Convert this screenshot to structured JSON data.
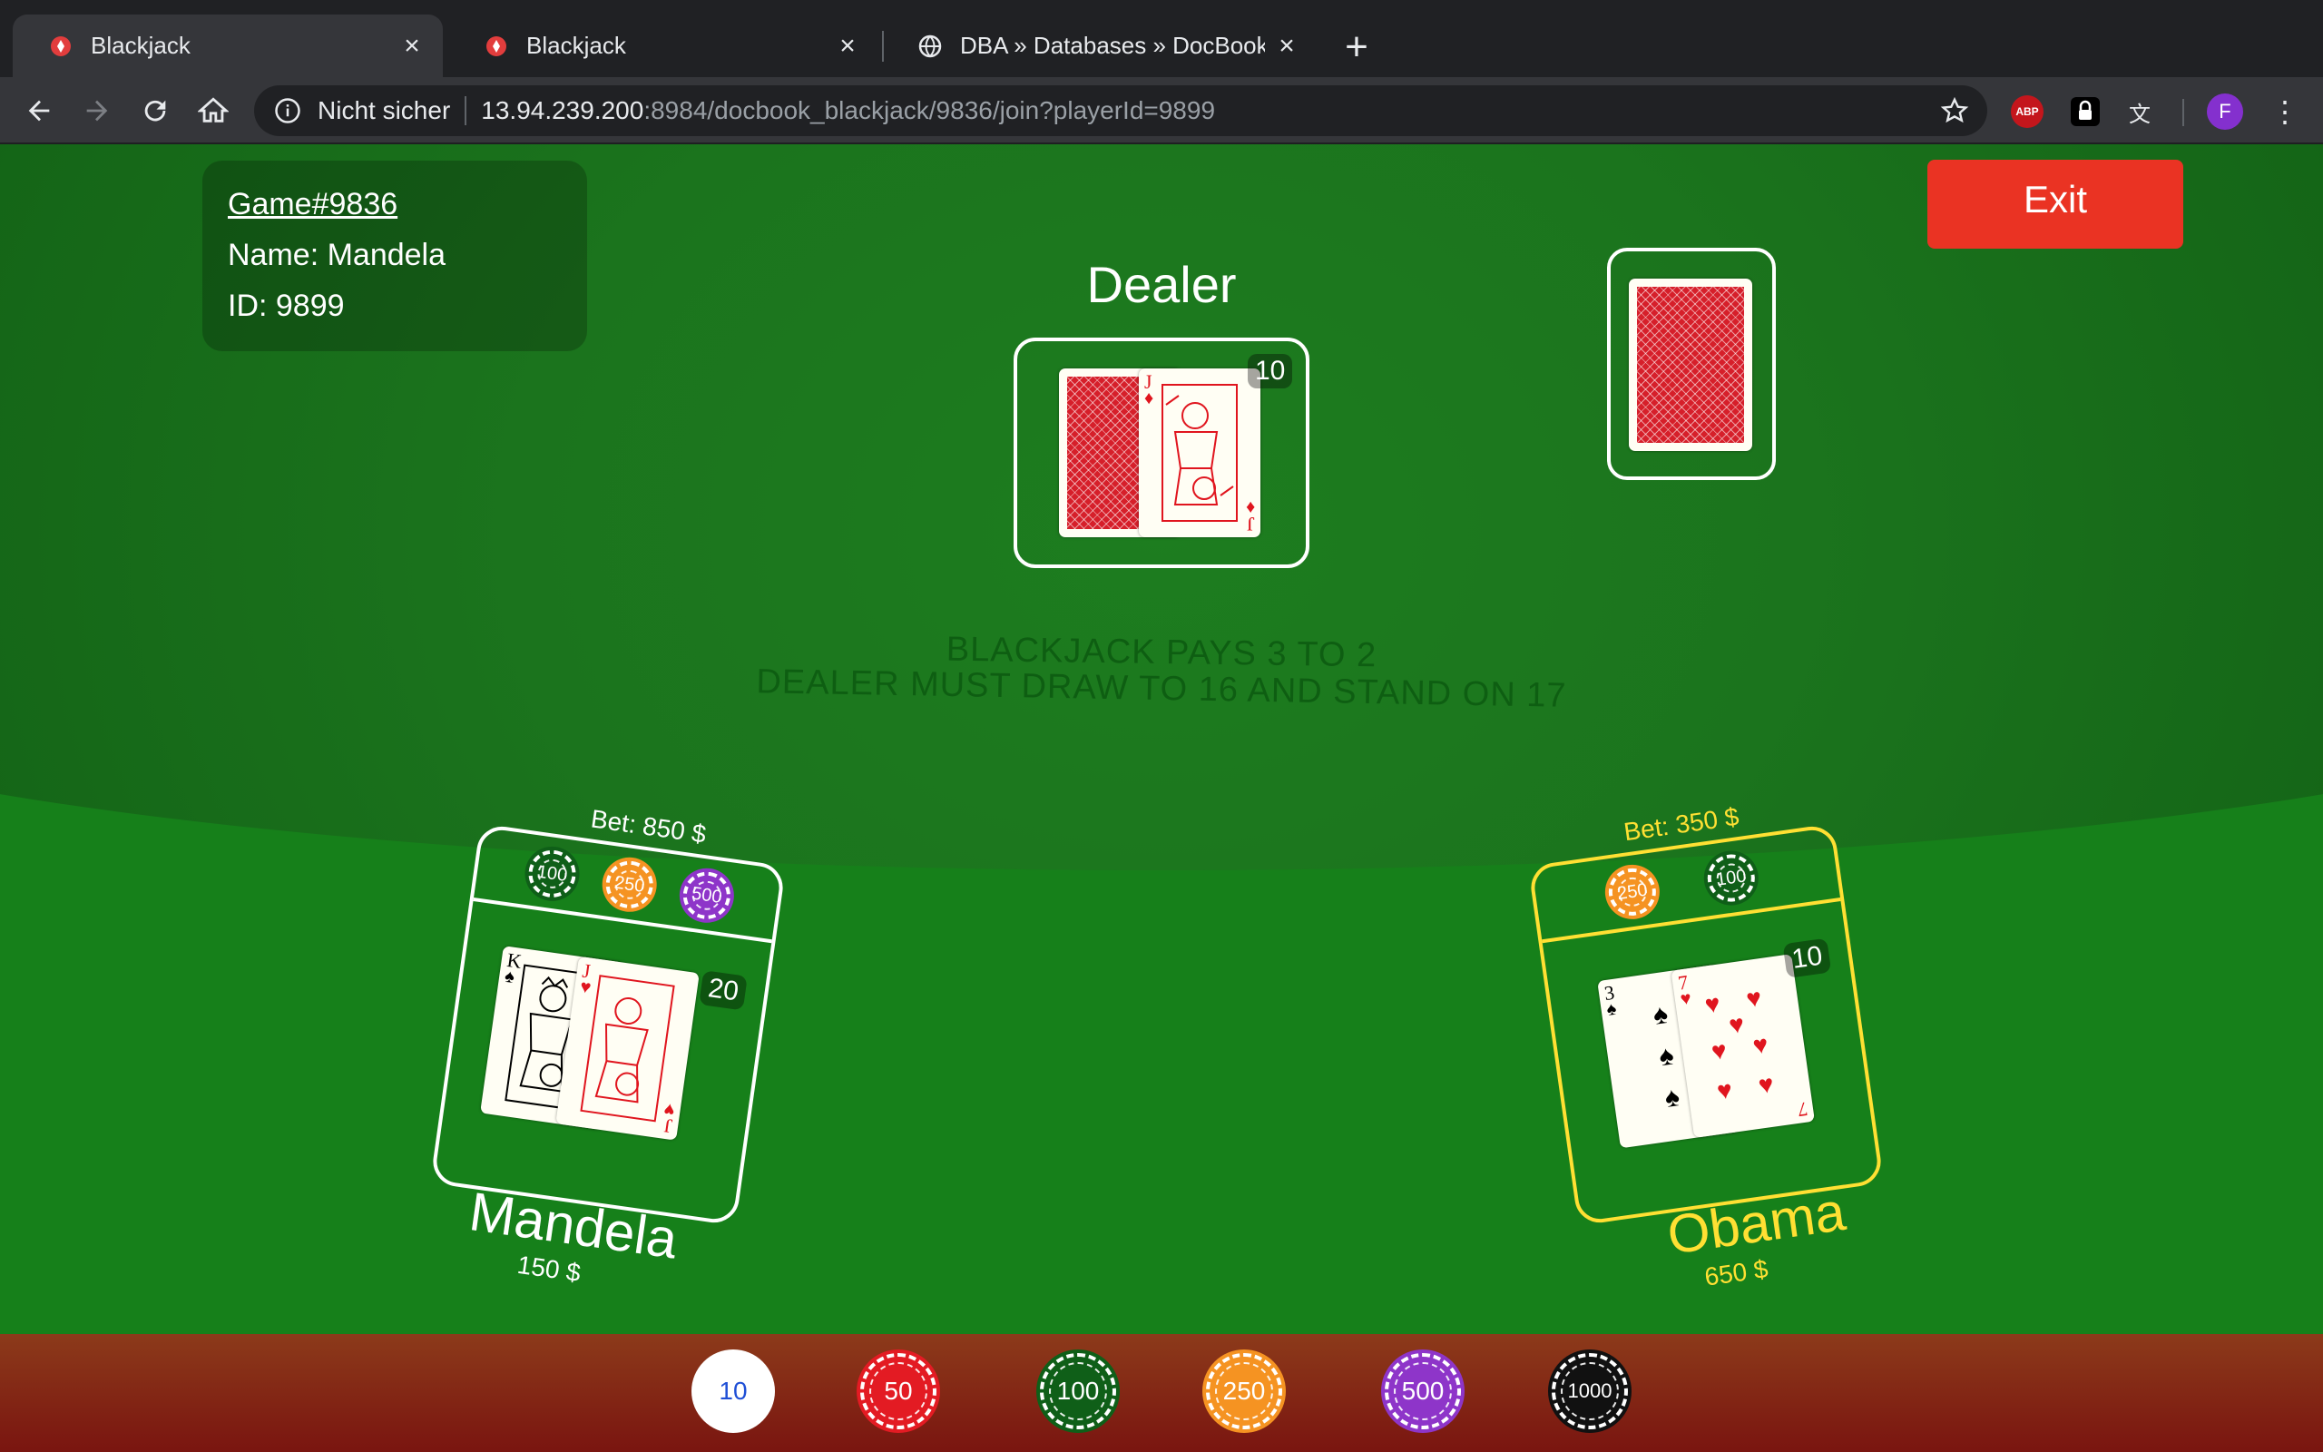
{
  "browser": {
    "tabs": [
      {
        "title": "Blackjack",
        "active": true
      },
      {
        "title": "Blackjack",
        "active": false
      },
      {
        "title": "DBA » Databases » DocBook_Lo",
        "active": false
      }
    ],
    "new_tab": "+",
    "omnibox": {
      "security": "Nicht sicher",
      "host": "13.94.239.200",
      "path": ":8984/docbook_blackjack/9836/join?playerId=9899"
    },
    "extensions": {
      "abp": "ABP",
      "translate": "文"
    },
    "profile_initial": "F",
    "menu": "⋮"
  },
  "game": {
    "info": {
      "game_link": "Game#9836",
      "name": "Name: Mandela",
      "id": "ID: 9899"
    },
    "exit_label": "Exit",
    "dealer": {
      "label": "Dealer",
      "score": "10",
      "cards": [
        {
          "face": "back"
        },
        {
          "rank": "J",
          "suit": "♦",
          "color": "red"
        }
      ]
    },
    "rules": {
      "line1": "BLACKJACK PAYS 3 TO 2",
      "line2": "DEALER MUST DRAW TO 16 AND STAND ON 17"
    },
    "players": [
      {
        "name": "Mandela",
        "money": "150 $",
        "bet": "Bet: 850 $",
        "score": "20",
        "chips": [
          "100",
          "250",
          "500"
        ],
        "cards": [
          {
            "rank": "K",
            "suit": "♠",
            "color": "black"
          },
          {
            "rank": "J",
            "suit": "♥",
            "color": "red"
          }
        ]
      },
      {
        "name": "Obama",
        "money": "650 $",
        "bet": "Bet: 350 $",
        "score": "10",
        "chips": [
          "250",
          "100"
        ],
        "cards": [
          {
            "rank": "3",
            "suit": "♠",
            "color": "black"
          },
          {
            "rank": "7",
            "suit": "♥",
            "color": "red"
          }
        ]
      }
    ],
    "tray_chips": [
      {
        "value": "10",
        "color": "#ffffff",
        "text_color": "#1f4fd6"
      },
      {
        "value": "50",
        "color": "#e31b23",
        "text_color": "#ffffff"
      },
      {
        "value": "100",
        "color": "#0f5f18",
        "text_color": "#ffffff"
      },
      {
        "value": "250",
        "color": "#f59322",
        "text_color": "#ffffff"
      },
      {
        "value": "500",
        "color": "#8e35c9",
        "text_color": "#ffffff"
      },
      {
        "value": "1000",
        "color": "#111111",
        "text_color": "#ffffff"
      }
    ],
    "colors": {
      "table": "#16801a",
      "exit": "#ea3323",
      "player_highlight": "#ffe033"
    }
  }
}
